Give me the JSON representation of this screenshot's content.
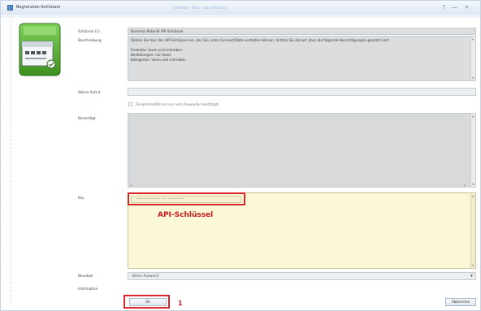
{
  "window": {
    "title": "Begrenzten-Schlüssel",
    "center_hint": "Einstellen · Klick · sich verfangen"
  },
  "form": {
    "labels": {
      "schluessel": "Schlüssel (1)",
      "beschreibung": "Beschreibung",
      "aktive_aufruf": "Aktive Aufruf",
      "berechtigungen": "Berechtigt",
      "key": "Key",
      "benutzer": "Benutzer",
      "information": "Information"
    },
    "schluessel_value": "Business Rebuild API-Schlüssel",
    "beschreibung_lines": [
      "Stellen Sie hier den API-Schlüssel ein, den Sie unter Connect/Datei erstellen können. Achten Sie darauf, dass die folgende Berechtigungen gesetzt sind:",
      "",
      "Produkte: lesen und schreiben",
      "Bestellungen: nur lesen",
      "Kategorien: lesen und schreiben"
    ],
    "checkbox_label": "Zusammenführen (nur vom Anwender bestätigt)",
    "key_value": "••••••••••••••• •• •••••••••",
    "benutzer_value": "(Keine Auswahl)"
  },
  "annotations": {
    "api_label": "API-Schlüssel",
    "step_label": "1"
  },
  "buttons": {
    "ok": "Ok",
    "abbrechen": "Abbrechen"
  },
  "colors": {
    "highlight": "#d9262b",
    "key_background": "#fbf8d8",
    "titlebar": "#dde7f3"
  }
}
